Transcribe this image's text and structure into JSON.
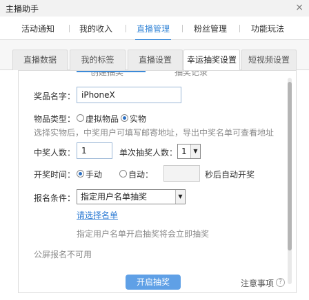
{
  "window": {
    "title": "主播助手",
    "close_glyph": "×"
  },
  "main_tabs": [
    "活动通知",
    "我的收入",
    "直播管理",
    "粉丝管理",
    "功能玩法"
  ],
  "sub_tabs": [
    "直播数据",
    "我的标签",
    "直播设置",
    "幸运抽奖设置",
    "短视频设置"
  ],
  "panel_peek": [
    "创建抽奖",
    "抽奖记录"
  ],
  "form": {
    "prize_label": "奖品名字：",
    "prize_value": "iPhoneX",
    "type_label": "物品类型：",
    "type_virtual": "虚拟物品",
    "type_physical": "实物",
    "type_hint": "选择实物后，中奖用户可填写邮寄地址，导出中奖名单可查看地址",
    "winners_label": "中奖人数：",
    "winners_value": "1",
    "per_draw_label": "单次抽奖人数：",
    "per_draw_value": "1",
    "time_label": "开奖时间：",
    "time_manual": "手动",
    "time_auto": "自动：",
    "time_auto_suffix": "秒后自动开奖",
    "signup_label": "报名条件：",
    "signup_value": "指定用户名单抽奖",
    "select_list_link": "请选择名单",
    "signup_hint": "指定用户名单开启抽奖将会立即抽奖",
    "public_screen": "公屏报名不可用"
  },
  "footer": {
    "start_button": "开启抽奖",
    "notes_link": "注意事项",
    "help_glyph": "?"
  },
  "colors": {
    "accent": "#3c8ad8",
    "button": "#5fa0e6"
  }
}
